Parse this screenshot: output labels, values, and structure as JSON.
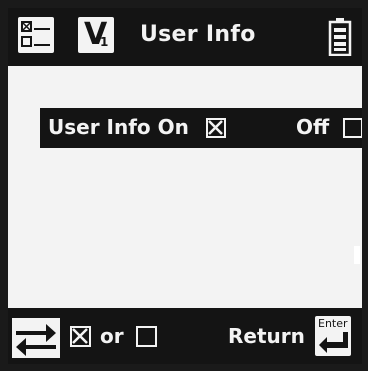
{
  "header": {
    "menu_icon": "checklist-icon",
    "mode_letter": "V",
    "mode_subscript": "1",
    "title": "User Info",
    "battery_icon": "battery-icon"
  },
  "option": {
    "label": "User Info On",
    "on_checked": true,
    "off_label": "Off",
    "off_checked": false
  },
  "footer": {
    "swap_icon": "swap-arrows-icon",
    "or_label": "or",
    "return_label": "Return",
    "enter_key_label": "Enter",
    "enter_icon": "enter-key-icon"
  },
  "colors": {
    "background": "#f3f3f3",
    "bar": "#141414"
  }
}
